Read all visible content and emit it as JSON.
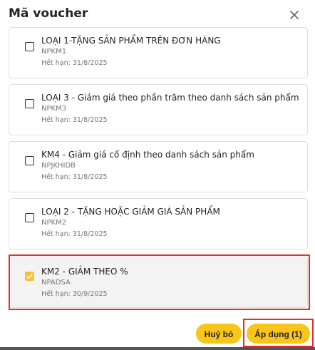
{
  "dialog": {
    "title": "Mã voucher",
    "close_icon": "close-icon"
  },
  "vouchers": [
    {
      "title": "LOẠI 1-TẶNG SẢN PHẨM TRÊN ĐƠN HÀNG",
      "code": "NPKM1",
      "expiry": "Hết hạn: 31/8/2025",
      "checked": false
    },
    {
      "title": "LOẠI 3 - Giảm giá theo phần trăm theo danh sách sản phẩm",
      "code": "NPKM3",
      "expiry": "Hết hạn: 31/8/2025",
      "checked": false
    },
    {
      "title": "KM4 - Giảm giá cố định theo danh sách sản phẩm",
      "code": "NPJKHIDB",
      "expiry": "Hết hạn: 31/8/2025",
      "checked": false
    },
    {
      "title": "LOẠI 2 - TẶNG HOẶC GIẢM GIÁ SẢN PHẨM",
      "code": "NPKM2",
      "expiry": "Hết hạn: 31/8/2025",
      "checked": false
    },
    {
      "title": "KM2 - GIẢM THEO %",
      "code": "NPADSA",
      "expiry": "Hết hạn: 30/9/2025",
      "checked": true
    }
  ],
  "footer": {
    "cancel_label": "Huỷ bỏ",
    "apply_label": "Áp dụng (1)"
  },
  "colors": {
    "accent": "#f9c51a",
    "checkbox_checked": "#f7c232",
    "highlight": "#e0321f",
    "selected_card_bg": "#f3f3f3"
  }
}
